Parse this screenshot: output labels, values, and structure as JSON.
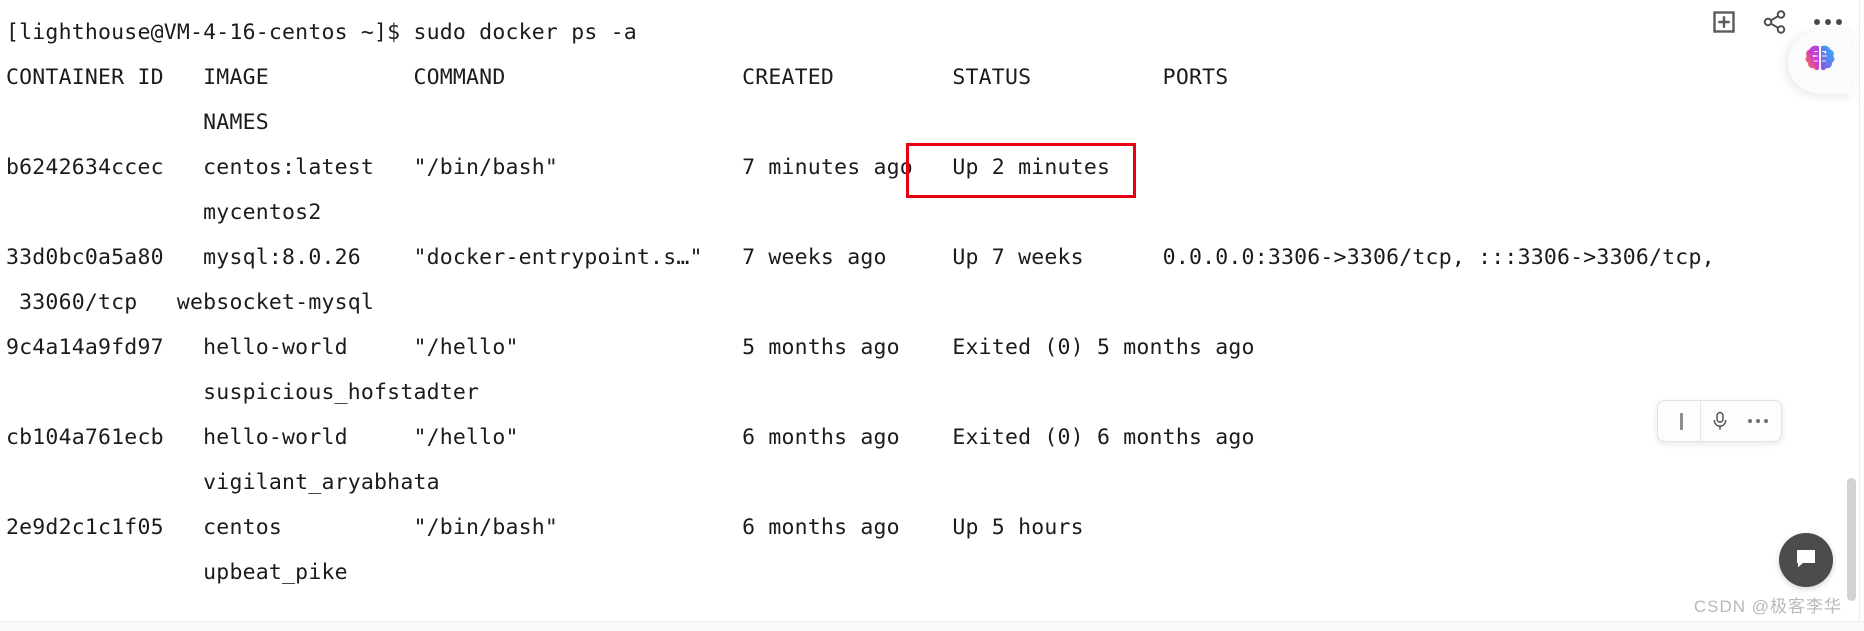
{
  "terminal": {
    "prompt_line": "[lighthouse@VM-4-16-centos ~]$ sudo docker ps -a",
    "header_line_1": "CONTAINER ID   IMAGE           COMMAND                  CREATED         STATUS          PORTS",
    "header_line_2": "               NAMES",
    "columns": [
      "CONTAINER ID",
      "IMAGE",
      "COMMAND",
      "CREATED",
      "STATUS",
      "PORTS",
      "NAMES"
    ],
    "rows": [
      {
        "line1": "b6242634ccec   centos:latest   \"/bin/bash\"              7 minutes ago   Up 2 minutes",
        "line2": "               mycentos2",
        "container_id": "b6242634ccec",
        "image": "centos:latest",
        "command": "\"/bin/bash\"",
        "created": "7 minutes ago",
        "status": "Up 2 minutes",
        "ports": "",
        "names": "mycentos2"
      },
      {
        "line1": "33d0bc0a5a80   mysql:8.0.26    \"docker-entrypoint.s…\"   7 weeks ago     Up 7 weeks      0.0.0.0:3306->3306/tcp, :::3306->3306/tcp,",
        "line2": " 33060/tcp   websocket-mysql",
        "container_id": "33d0bc0a5a80",
        "image": "mysql:8.0.26",
        "command": "\"docker-entrypoint.s…\"",
        "created": "7 weeks ago",
        "status": "Up 7 weeks",
        "ports": "0.0.0.0:3306->3306/tcp, :::3306->3306/tcp, 33060/tcp",
        "names": "websocket-mysql"
      },
      {
        "line1": "9c4a14a9fd97   hello-world     \"/hello\"                 5 months ago    Exited (0) 5 months ago",
        "line2": "               suspicious_hofstadter",
        "container_id": "9c4a14a9fd97",
        "image": "hello-world",
        "command": "\"/hello\"",
        "created": "5 months ago",
        "status": "Exited (0) 5 months ago",
        "ports": "",
        "names": "suspicious_hofstadter"
      },
      {
        "line1": "cb104a761ecb   hello-world     \"/hello\"                 6 months ago    Exited (0) 6 months ago",
        "line2": "               vigilant_aryabhata",
        "container_id": "cb104a761ecb",
        "image": "hello-world",
        "command": "\"/hello\"",
        "created": "6 months ago",
        "status": "Exited (0) 6 months ago",
        "ports": "",
        "names": "vigilant_aryabhata"
      },
      {
        "line1": "2e9d2c1c1f05   centos          \"/bin/bash\"              6 months ago    Up 5 hours",
        "line2": "               upbeat_pike",
        "container_id": "2e9d2c1c1f05",
        "image": "centos",
        "command": "\"/bin/bash\"",
        "created": "6 months ago",
        "status": "Up 5 hours",
        "ports": "",
        "names": "upbeat_pike"
      }
    ]
  },
  "annotation": {
    "highlight_target": "Up 2 minutes",
    "highlight_color": "#e60012"
  },
  "top_right_tools": [
    {
      "name": "add-box-icon",
      "label": ""
    },
    {
      "name": "share-icon",
      "label": ""
    },
    {
      "name": "more-options-icon",
      "label": ""
    }
  ],
  "ai_pill": {
    "name": "ai-assistant-icon",
    "gradient_start": "#f0860a",
    "gradient_mid": "#c33bd0",
    "gradient_end": "#3fa9f5"
  },
  "floating_toolbar": {
    "items": [
      {
        "name": "text-caret-icon"
      },
      {
        "name": "microphone-icon"
      },
      {
        "name": "more-options-icon"
      }
    ]
  },
  "chat_fab": {
    "name": "chat-bubble-icon"
  },
  "watermark": {
    "text": "CSDN @极客李华"
  }
}
